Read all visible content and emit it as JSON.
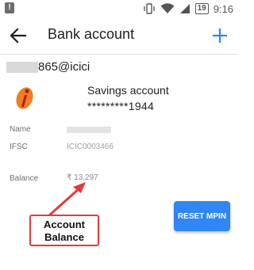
{
  "status_bar": {
    "battery": "19",
    "time": "9:16"
  },
  "app_bar": {
    "title": "Bank account"
  },
  "account": {
    "vpa_suffix": "865@icici",
    "type": "Savings account",
    "number": "*********1944"
  },
  "details": {
    "name_label": "Name",
    "ifsc_label": "IFSC",
    "ifsc_value": "ICIC0003466",
    "balance_label": "Balance",
    "balance_value": "₹ 13,297"
  },
  "actions": {
    "reset_mpin": "RESET MPIN"
  },
  "annotation": {
    "line1": "Account",
    "line2": "Balance"
  },
  "colors": {
    "accent": "#2f86f4",
    "annotation_red": "#e23b3b",
    "bank_logo_orange": "#f07d20",
    "bank_logo_red": "#b0182e"
  },
  "icons": {
    "back": "arrow-left-icon",
    "add": "plus-icon",
    "wifi": "wifi-icon",
    "vibrate": "vibrate-icon",
    "signal": "signal-icon",
    "battery": "battery-icon",
    "bank_logo": "icici-logo-icon"
  }
}
